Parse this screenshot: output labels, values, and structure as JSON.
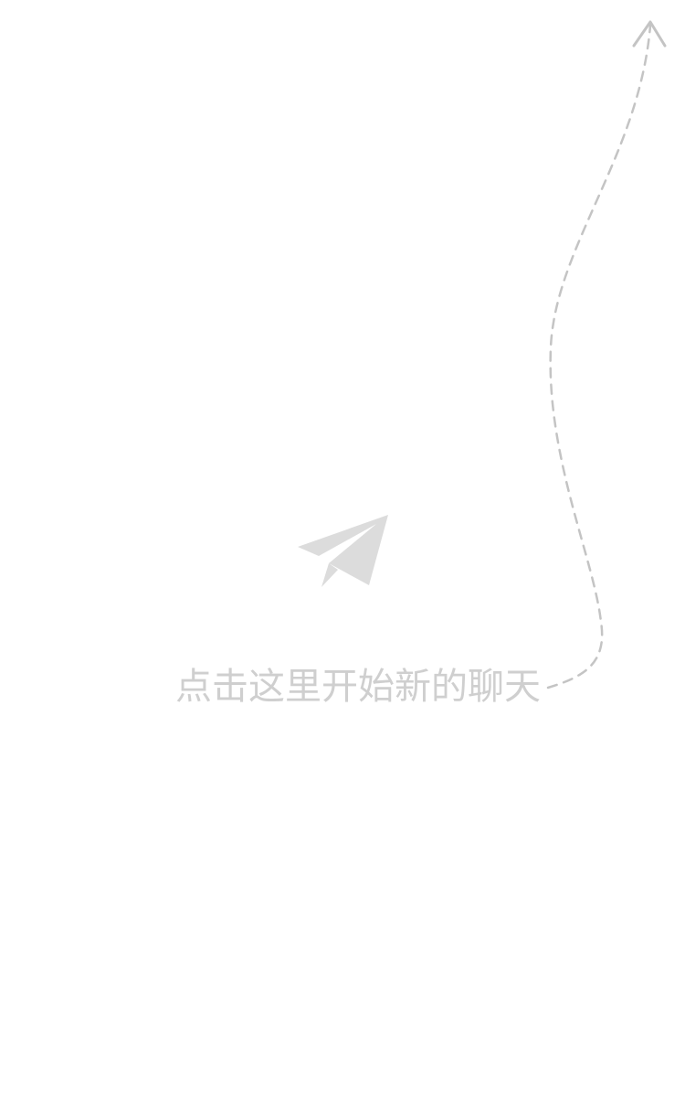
{
  "empty_state": {
    "hint_text": "点击这里开始新的聊天",
    "icon": "paper-plane-icon",
    "arrow_icon": "up-arrow-icon"
  },
  "colors": {
    "background": "#ffffff",
    "hint_text": "#cfcfcf",
    "plane_icon": "#dcdcdc",
    "arrow_line": "#c4c4c4"
  }
}
